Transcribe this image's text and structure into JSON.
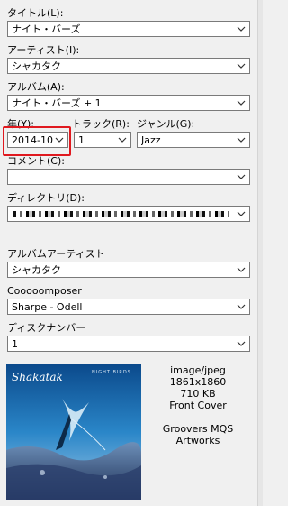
{
  "fields": {
    "title": {
      "label": "タイトル(L):",
      "value": "ナイト・バーズ"
    },
    "artist": {
      "label": "アーティスト(I):",
      "value": "シャカタク"
    },
    "album": {
      "label": "アルバム(A):",
      "value": "ナイト・バーズ + 1"
    },
    "year": {
      "label": "年(Y):",
      "value": "2014-10"
    },
    "track": {
      "label": "トラック(R):",
      "value": "1"
    },
    "genre": {
      "label": "ジャンル(G):",
      "value": "Jazz"
    },
    "comment": {
      "label": "コメント(C):",
      "value": ""
    },
    "directory": {
      "label": "ディレクトリ(D):",
      "value": ""
    },
    "album_artist": {
      "label": "アルバムアーティスト",
      "value": "シャカタク"
    },
    "composer": {
      "label": "Cooooomposer",
      "value": "Sharpe - Odell"
    },
    "disc_number": {
      "label": "ディスクナンバー",
      "value": "1"
    }
  },
  "artwork": {
    "cover_text": "NIGHT BIRDS",
    "logo_text": "Shakatak",
    "mime": "image/jpeg",
    "dimensions": "1861x1860",
    "size": "710 KB",
    "type": "Front Cover",
    "description_line1": "Groovers MQS",
    "description_line2": "Artworks"
  },
  "colors": {
    "highlight": "#e0191f",
    "sky": "#1f6fb3",
    "ground": "#3d5a87"
  },
  "icons": {
    "dropdown": "chevron-down-icon"
  }
}
